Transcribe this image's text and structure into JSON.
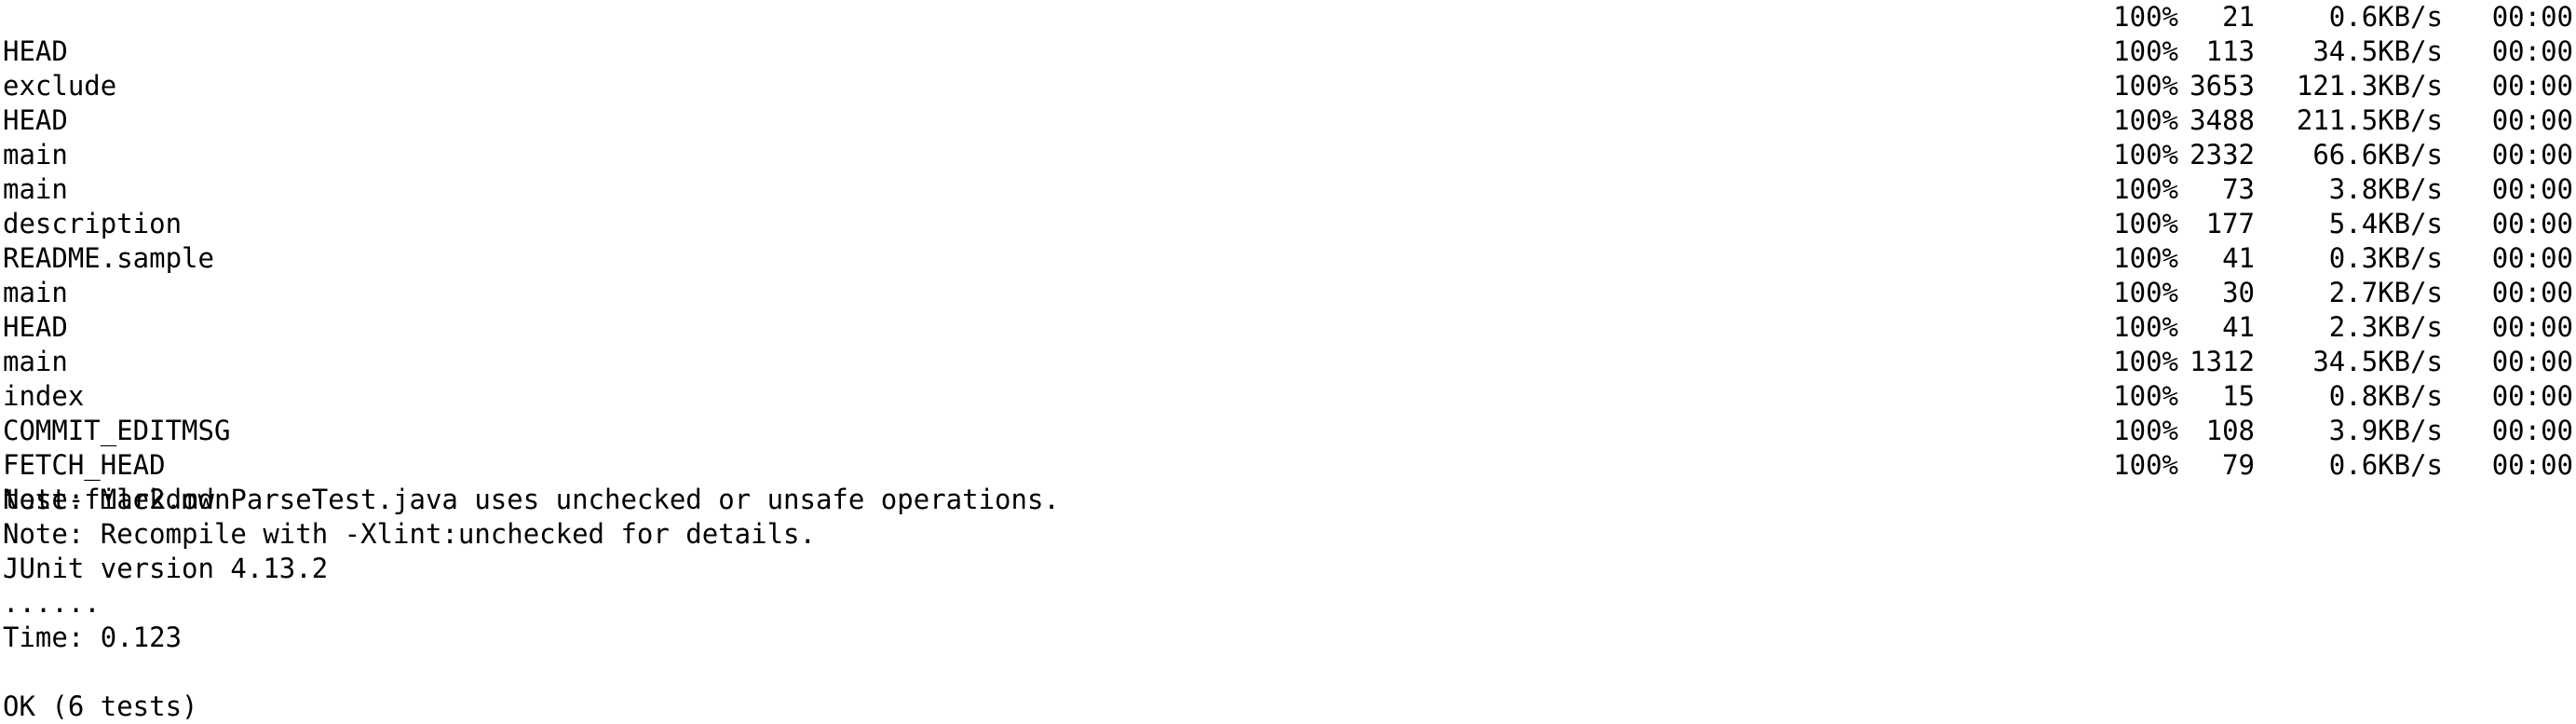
{
  "transfers": [
    {
      "name": "HEAD",
      "percent": "100%",
      "bytes": "21",
      "speed": "0.6KB/s",
      "eta": "00:00"
    },
    {
      "name": "exclude",
      "percent": "100%",
      "bytes": "113",
      "speed": "34.5KB/s",
      "eta": "00:00"
    },
    {
      "name": "HEAD",
      "percent": "100%",
      "bytes": "3653",
      "speed": "121.3KB/s",
      "eta": "00:00"
    },
    {
      "name": "main",
      "percent": "100%",
      "bytes": "3488",
      "speed": "211.5KB/s",
      "eta": "00:00"
    },
    {
      "name": "main",
      "percent": "100%",
      "bytes": "2332",
      "speed": "66.6KB/s",
      "eta": "00:00"
    },
    {
      "name": "description",
      "percent": "100%",
      "bytes": "73",
      "speed": "3.8KB/s",
      "eta": "00:00"
    },
    {
      "name": "README.sample",
      "percent": "100%",
      "bytes": "177",
      "speed": "5.4KB/s",
      "eta": "00:00"
    },
    {
      "name": "main",
      "percent": "100%",
      "bytes": "41",
      "speed": "0.3KB/s",
      "eta": "00:00"
    },
    {
      "name": "HEAD",
      "percent": "100%",
      "bytes": "30",
      "speed": "2.7KB/s",
      "eta": "00:00"
    },
    {
      "name": "main",
      "percent": "100%",
      "bytes": "41",
      "speed": "2.3KB/s",
      "eta": "00:00"
    },
    {
      "name": "index",
      "percent": "100%",
      "bytes": "1312",
      "speed": "34.5KB/s",
      "eta": "00:00"
    },
    {
      "name": "COMMIT_EDITMSG",
      "percent": "100%",
      "bytes": "15",
      "speed": "0.8KB/s",
      "eta": "00:00"
    },
    {
      "name": "FETCH_HEAD",
      "percent": "100%",
      "bytes": "108",
      "speed": "3.9KB/s",
      "eta": "00:00"
    },
    {
      "name": "test-file2.md",
      "percent": "100%",
      "bytes": "79",
      "speed": "0.6KB/s",
      "eta": "00:00"
    }
  ],
  "output_lines": [
    "Note: MarkdownParseTest.java uses unchecked or unsafe operations.",
    "Note: Recompile with -Xlint:unchecked for details.",
    "JUnit version 4.13.2",
    "......",
    "Time: 0.123",
    "",
    "OK (6 tests)"
  ],
  "colors": {
    "background": "#ffffff",
    "text": "#000000"
  }
}
